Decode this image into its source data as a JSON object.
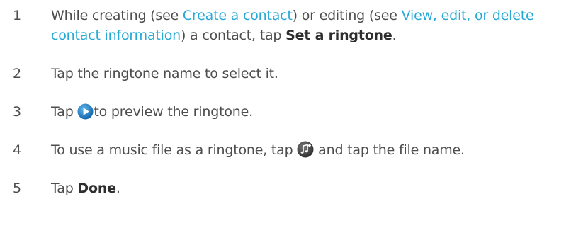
{
  "steps": [
    {
      "number": "1",
      "text_before": "While creating (see ",
      "link1": "Create a contact",
      "text_mid": ") or editing (see ",
      "link2": "View, edit, or delete contact information",
      "text_after": ") a contact, tap ",
      "bold": "Set a ringtone",
      "end": "."
    },
    {
      "number": "2",
      "text": "Tap the ringtone name to select it."
    },
    {
      "number": "3",
      "text_before": "Tap ",
      "icon": "play-icon",
      "text_after": "to preview the ringtone."
    },
    {
      "number": "4",
      "text_before": "To use a music file as a ringtone, tap ",
      "icon": "add-music-icon",
      "text_after": " and tap the file name."
    },
    {
      "number": "5",
      "text_before": "Tap ",
      "bold": "Done",
      "end": "."
    }
  ],
  "colors": {
    "text": "#4d4d4d",
    "link": "#27a9d6",
    "icon_blue": "#1e7fc4"
  }
}
